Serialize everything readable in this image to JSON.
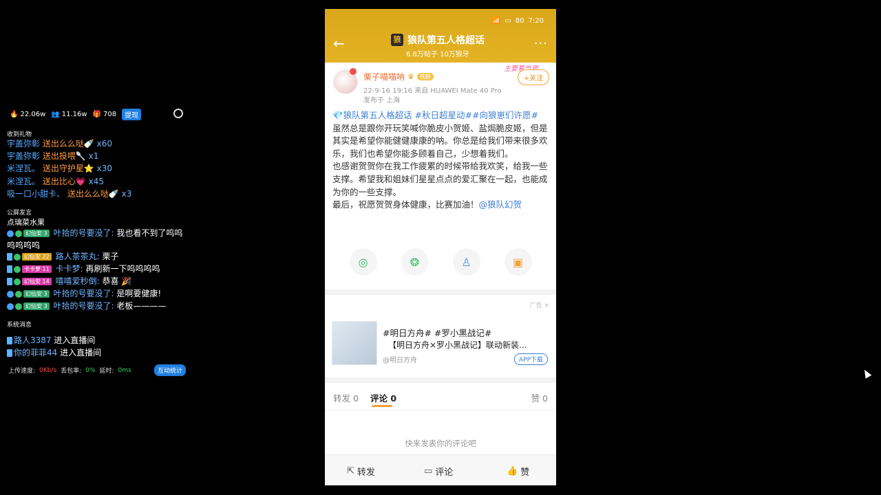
{
  "overlay": {
    "stats": {
      "popularity": "22.06w",
      "viewers": "11.16w",
      "gifts": "708",
      "cash_btn": "提现"
    },
    "gifts_title": "收到礼物",
    "gift_lines": [
      {
        "user": "宇盖弥彰",
        "action": "送出么么哒",
        "count": "x60"
      },
      {
        "user": "宇盖弥彰",
        "action": "送出投喂",
        "count": "x1"
      },
      {
        "user": "米涅瓦。",
        "action": "送出守护星",
        "count": "x30"
      },
      {
        "user": "米涅瓦。",
        "action": "送出比心",
        "count": "x45"
      },
      {
        "user": "吸一口小甜卡、",
        "action": "送出么么哒",
        "count": "x3"
      }
    ],
    "chat_title": "公屏发言",
    "chat_first": "点璃菜水果",
    "chat_lines": [
      {
        "badge": "幻仙安 3",
        "user": "叶拾的号要没了:",
        "text": "我也看不到了呜呜",
        "text2": "呜呜呜呜"
      },
      {
        "badge": "幻仙安 22",
        "user": "路人茶茶丸:",
        "text": "栗子"
      },
      {
        "badge": "卡卡萝 11",
        "user": "卡卡梦:",
        "text": "再刷新一下呜呜呜呜"
      },
      {
        "badge": "幻仙安 14",
        "user": "嘻嘻爱秒倒:",
        "text": "恭喜"
      },
      {
        "badge": "幻仙安 3",
        "user": "叶拾的号要没了:",
        "text": "是啊要健康!"
      },
      {
        "badge": "幻仙安 3",
        "user": "叶拾的号要没了:",
        "text": "老板————"
      }
    ],
    "system_title": "系统消息",
    "system_lines": [
      {
        "user": "路人3387",
        "text": "进入直播间"
      },
      {
        "user": "你的菲菲44",
        "text": "进入直播间"
      }
    ],
    "footer": {
      "upload_label": "上传速度:",
      "upload_value": "0Kb/s",
      "loss_label": "丢包率:",
      "loss_value": "0%",
      "latency_label": "延时:",
      "latency_value": "0ms",
      "interact_btn": "互动统计"
    }
  },
  "phone": {
    "status_time": "7:20",
    "status_battery": "80",
    "topic_title": "狼队第五人格超话",
    "topic_logo": "狼",
    "topic_sub": "6.8万帖子 10万狼牙",
    "post": {
      "author": "栗子喵喵呐",
      "vip_label": "铁粉",
      "follow_btn": "+关注",
      "deco_text": "主要看气质",
      "date": "22-9-16 19:16",
      "source": "来自 HUAWEI Mate 40 Pro",
      "location": "发布于 上海",
      "topics": "💎狼队第五人格超话 #秋日超星动##向狼崽们许愿#",
      "p1": "虽然总是跟你开玩笑喊你脆皮小贺姬、盐焗脆皮姬，但是其实是希望你能健健康康的呐。你总是给我们带来很多欢乐，我们也希望你能多顾着自己，少想着我们。",
      "p2": "也感谢贺贺你在我工作疲累的时候带给我欢笑，给我一些支撑。希望我和姐妹们星星点点的爱汇聚在一起，也能成为你的一些支撑。",
      "p3_prefix": "最后，祝愿贺贺身体健康，比赛加油！",
      "p3_mention": "@狼队幻贺"
    },
    "share_icons": [
      "wechat-icon",
      "moments-icon",
      "qq-icon",
      "image-icon"
    ],
    "ad": {
      "label": "广告 ✕",
      "tags": "#明日方舟# #罗小黑战记#",
      "title": "【明日方舟×罗小黑战记】联动新装...",
      "source": "@明日方舟",
      "btn": "APP下载"
    },
    "tabs": {
      "repost": "转发 0",
      "comment": "评论 0",
      "like": "赞 0"
    },
    "empty_text": "快来发表你的评论吧",
    "bottom": {
      "repost": "转发",
      "comment": "评论",
      "like": "赞"
    }
  }
}
